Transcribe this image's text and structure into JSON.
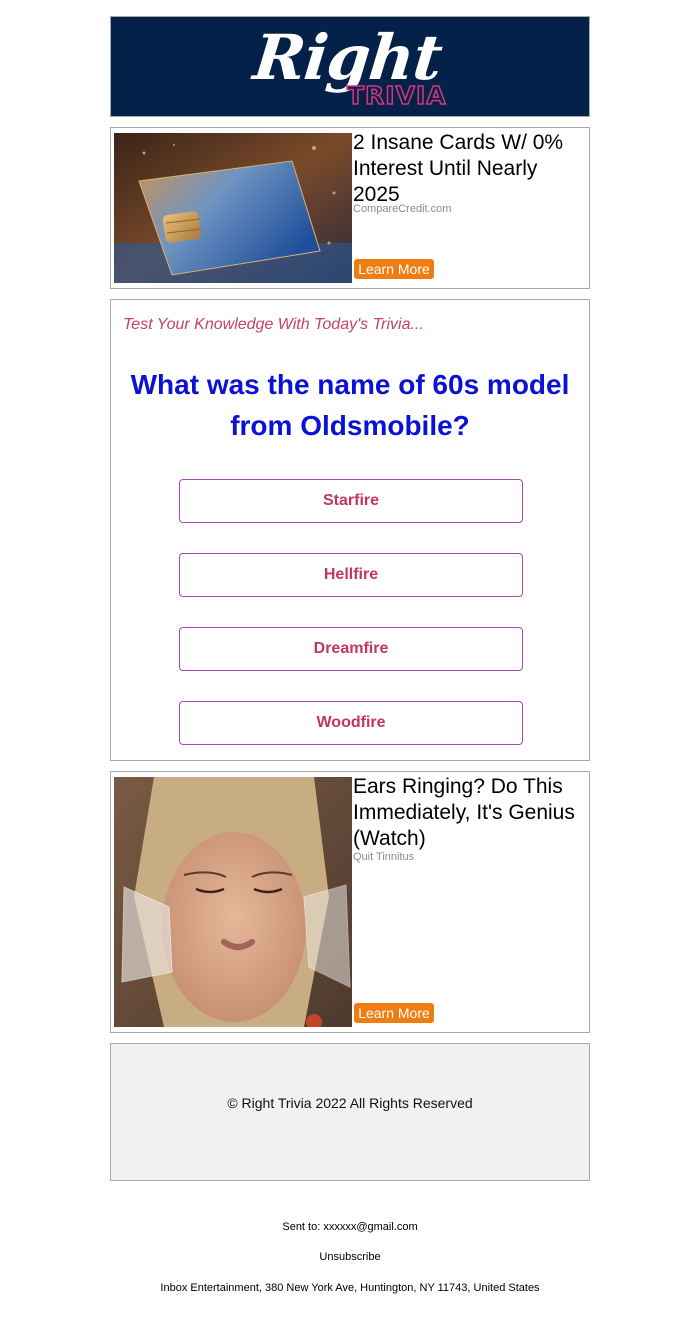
{
  "header": {
    "logo_script": "Right",
    "logo_sub": "TRIVIA"
  },
  "ads": [
    {
      "title": "2 Insane Cards W/ 0% Interest Until Nearly 2025",
      "source": "CompareCredit.com",
      "button": "Learn More",
      "image": "credit-card-photo"
    },
    {
      "title": "Ears Ringing? Do This Immediately, It's Genius (Watch)",
      "source": "Quit Tinnitus",
      "button": "Learn More",
      "image": "woman-with-cups-on-ears-photo"
    }
  ],
  "trivia": {
    "tagline": "Test Your Knowledge With Today's Trivia...",
    "question": "What was the name of 60s model from Oldsmobile?",
    "answers": [
      "Starfire",
      "Hellfire",
      "Dreamfire",
      "Woodfire"
    ]
  },
  "footer": {
    "copyright": "© Right Trivia 2022 All Rights Reserved",
    "sent_to": "Sent to: xxxxxx@gmail.com",
    "unsubscribe": "Unsubscribe",
    "address": "Inbox Entertainment, 380 New York Ave, Huntington, NY 11743, United States"
  },
  "colors": {
    "header_bg": "#04214a",
    "accent_pink": "#d9357c",
    "question_blue": "#0a12d6",
    "answer_text": "#c2365f",
    "answer_border": "#a24ab0",
    "cta_orange": "#f07d12",
    "footer_bg": "#f1f1f1"
  }
}
